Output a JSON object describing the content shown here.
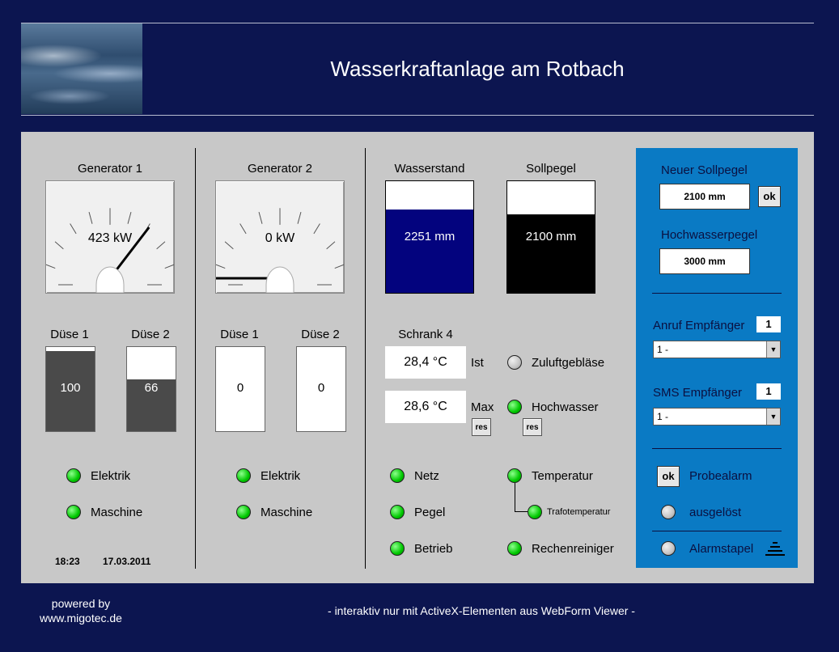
{
  "header": {
    "title": "Wasserkraftanlage am Rotbach"
  },
  "generators": [
    {
      "label": "Generator 1",
      "value": "423 kW",
      "needle_fraction": 0.7,
      "nozzles": [
        {
          "label": "Düse 1",
          "value": "100",
          "fill_percent": 95
        },
        {
          "label": "Düse 2",
          "value": "66",
          "fill_percent": 62
        }
      ],
      "status": [
        {
          "label": "Elektrik",
          "state": "on"
        },
        {
          "label": "Maschine",
          "state": "on"
        }
      ]
    },
    {
      "label": "Generator 2",
      "value": "0 kW",
      "needle_fraction": 0.0,
      "nozzles": [
        {
          "label": "Düse 1",
          "value": "0",
          "fill_percent": 0
        },
        {
          "label": "Düse 2",
          "value": "0",
          "fill_percent": 0
        }
      ],
      "status": [
        {
          "label": "Elektrik",
          "state": "on"
        },
        {
          "label": "Maschine",
          "state": "on"
        }
      ]
    }
  ],
  "levels": {
    "wasserstand": {
      "label": "Wasserstand",
      "value": "2251 mm",
      "fill_percent": 75,
      "color": "#03037e"
    },
    "sollpegel": {
      "label": "Sollpegel",
      "value": "2100 mm",
      "fill_percent": 70,
      "color": "#000000"
    }
  },
  "schrank": {
    "label": "Schrank 4",
    "ist_value": "28,4 °C",
    "ist_label": "Ist",
    "max_value": "28,6 °C",
    "max_label": "Max",
    "reset_label": "res",
    "zuluft": {
      "label": "Zuluftgebläse",
      "state": "off"
    },
    "hochwasser": {
      "label": "Hochwasser",
      "state": "on"
    }
  },
  "status_lights": {
    "netz": "Netz",
    "pegel": "Pegel",
    "betrieb": "Betrieb",
    "temperatur": "Temperatur",
    "trafotemperatur": "Trafotemperatur",
    "rechenreiniger": "Rechenreiniger"
  },
  "datetime": {
    "time": "18:23",
    "date": "17.03.2011"
  },
  "alarm_panel": {
    "new_level_label": "Neuer Sollpegel",
    "new_level_value": "2100 mm",
    "ok_label": "ok",
    "flood_level_label": "Hochwasserpegel",
    "flood_level_value": "3000 mm",
    "call_receiver_label": "Anruf Empfänger",
    "call_receiver_num": "1",
    "call_receiver_select": "1 -",
    "sms_receiver_label": "SMS Empfänger",
    "sms_receiver_num": "1",
    "sms_receiver_select": "1 -",
    "test_alarm_label": "Probealarm",
    "triggered_label": "ausgelöst",
    "alarm_stack_label": "Alarmstapel"
  },
  "footer": {
    "powered_by": "powered by",
    "site": "www.migotec.de",
    "note": "- interaktiv nur mit ActiveX-Elementen aus WebForm Viewer -"
  },
  "colors": {
    "background": "#0c1550",
    "panel": "#c8c8c8",
    "alarm_panel": "#0a7ac4",
    "led_on": "#00c800",
    "bar_fill": "#4a4a4a"
  }
}
